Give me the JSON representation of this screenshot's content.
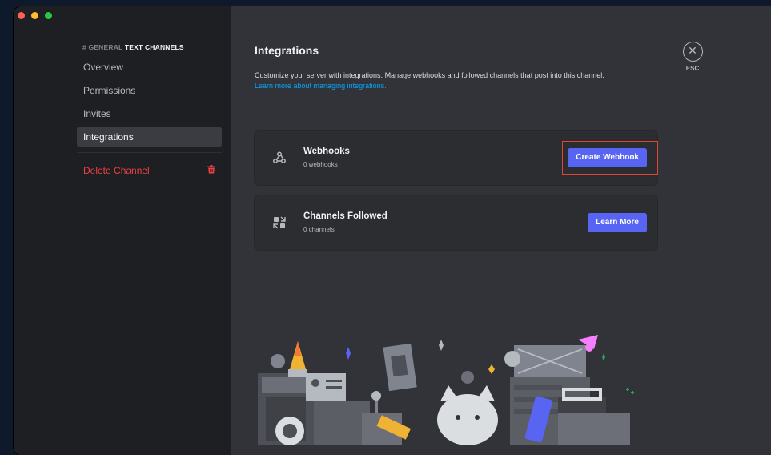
{
  "sidebar": {
    "section_prefix": "# GENERAL",
    "section_title": "TEXT CHANNELS",
    "items": [
      {
        "label": "Overview"
      },
      {
        "label": "Permissions"
      },
      {
        "label": "Invites"
      },
      {
        "label": "Integrations"
      }
    ],
    "delete_label": "Delete Channel"
  },
  "main": {
    "title": "Integrations",
    "description": "Customize your server with integrations. Manage webhooks and followed channels that post into this channel.",
    "learn_link": "Learn more about managing integrations.",
    "cards": [
      {
        "title": "Webhooks",
        "subtitle": "0 webhooks",
        "button": "Create Webhook",
        "icon": "webhook-icon"
      },
      {
        "title": "Channels Followed",
        "subtitle": "0 channels",
        "button": "Learn More",
        "icon": "channels-followed-icon"
      }
    ]
  },
  "esc": {
    "label": "ESC"
  },
  "colors": {
    "accent": "#5865f2",
    "danger": "#f23f43",
    "link": "#00a8fc",
    "highlight_box": "#e34234"
  }
}
